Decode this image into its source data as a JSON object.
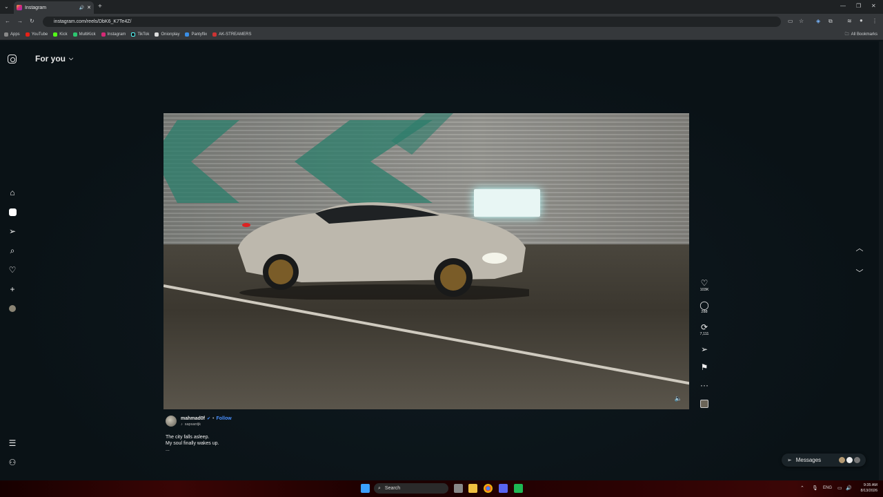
{
  "browser": {
    "tab_title": "Instagram",
    "url": "instagram.com/reels/DbK6_K7Te4Z/",
    "bookmarks": [
      "Apps",
      "YouTube",
      "Kick",
      "MultiKick",
      "Instagram",
      "TikTok",
      "Onionplay",
      "Pantyflix",
      "AK-STREAMERS"
    ],
    "all_bookmarks": "All Bookmarks"
  },
  "header": {
    "title": "For you"
  },
  "reel": {
    "likes": "103K",
    "comments": "288",
    "reposts": "7,111",
    "author": "mahmad0f",
    "follow_label": "Follow",
    "audio": "sapsantjk",
    "caption_line1": "The city falls asleep.",
    "caption_line2": "My soul finally wakes up.",
    "more": "..."
  },
  "messages_label": "Messages",
  "taskbar": {
    "search_label": "Search",
    "lang": "ENG",
    "time": "9:35 AM",
    "date": "8/13/2026"
  },
  "colors": {
    "accent_blue": "#4a90ff",
    "ig_gradient": "#d62976"
  }
}
